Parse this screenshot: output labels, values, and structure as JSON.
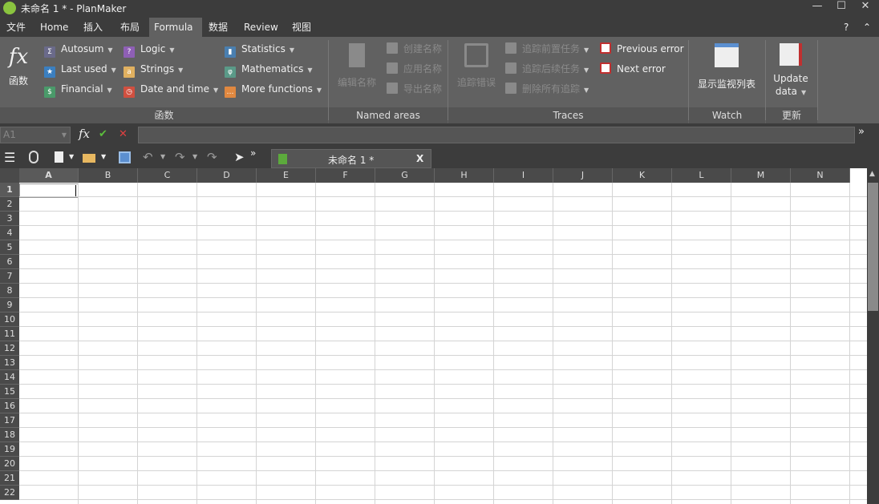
{
  "window": {
    "title": "未命名 1 * - PlanMaker",
    "controls": [
      "—",
      "☐",
      "✕"
    ]
  },
  "menu_tabs": [
    {
      "label": "文件"
    },
    {
      "label": "Home"
    },
    {
      "label": "插入"
    },
    {
      "label": "布局"
    },
    {
      "label": "Formula",
      "active": true
    },
    {
      "label": "数据"
    },
    {
      "label": "Review"
    },
    {
      "label": "视图"
    }
  ],
  "help": "?",
  "collapse": "⌃",
  "ribbon": {
    "functions": {
      "big_label": "函数",
      "group": "函数",
      "items": [
        {
          "label": "Autosum",
          "icon": "sigma-icon",
          "color": "#6a6a8a"
        },
        {
          "label": "Logic",
          "icon": "question-icon",
          "color": "#8e5fb5"
        },
        {
          "label": "Statistics",
          "icon": "bar-chart-icon",
          "color": "#4a7fb0"
        },
        {
          "label": "Last used",
          "icon": "star-icon",
          "color": "#3b7fc0"
        },
        {
          "label": "Strings",
          "icon": "letter-a-icon",
          "color": "#e0b060"
        },
        {
          "label": "Mathematics",
          "icon": "phi-icon",
          "color": "#5a9a88"
        },
        {
          "label": "Financial",
          "icon": "dollar-icon",
          "color": "#4a9a6a"
        },
        {
          "label": "Date and time",
          "icon": "clock-icon",
          "color": "#d05040"
        },
        {
          "label": "More functions",
          "icon": "ellipsis-icon",
          "color": "#e08840"
        }
      ]
    },
    "named": {
      "group": "Named areas",
      "big_label": "编辑名称",
      "items": [
        "创建名称",
        "应用名称",
        "导出名称"
      ]
    },
    "traces": {
      "group": "Traces",
      "big_label": "追踪错误",
      "items": [
        "追踪前置任务",
        "追踪后续任务",
        "删除所有追踪"
      ],
      "prev": "Previous error",
      "next": "Next error"
    },
    "watch": {
      "group": "Watch",
      "big_label": "显示监视列表"
    },
    "update": {
      "group": "更新",
      "line1": "Update",
      "line2": "data"
    }
  },
  "formula_bar": {
    "cell_ref": "A1",
    "fx": "fx",
    "ok": "✔",
    "cancel": "✕",
    "value": ""
  },
  "doc_tab": {
    "label": "未命名 1 *",
    "close": "X"
  },
  "columns": [
    "A",
    "B",
    "C",
    "D",
    "E",
    "F",
    "G",
    "H",
    "I",
    "J",
    "K",
    "L",
    "M",
    "N"
  ],
  "rows": [
    "1",
    "2",
    "3",
    "4",
    "5",
    "6",
    "7",
    "8",
    "9",
    "10",
    "11",
    "12",
    "13",
    "14",
    "15",
    "16",
    "17",
    "18",
    "19",
    "20",
    "21",
    "22"
  ]
}
